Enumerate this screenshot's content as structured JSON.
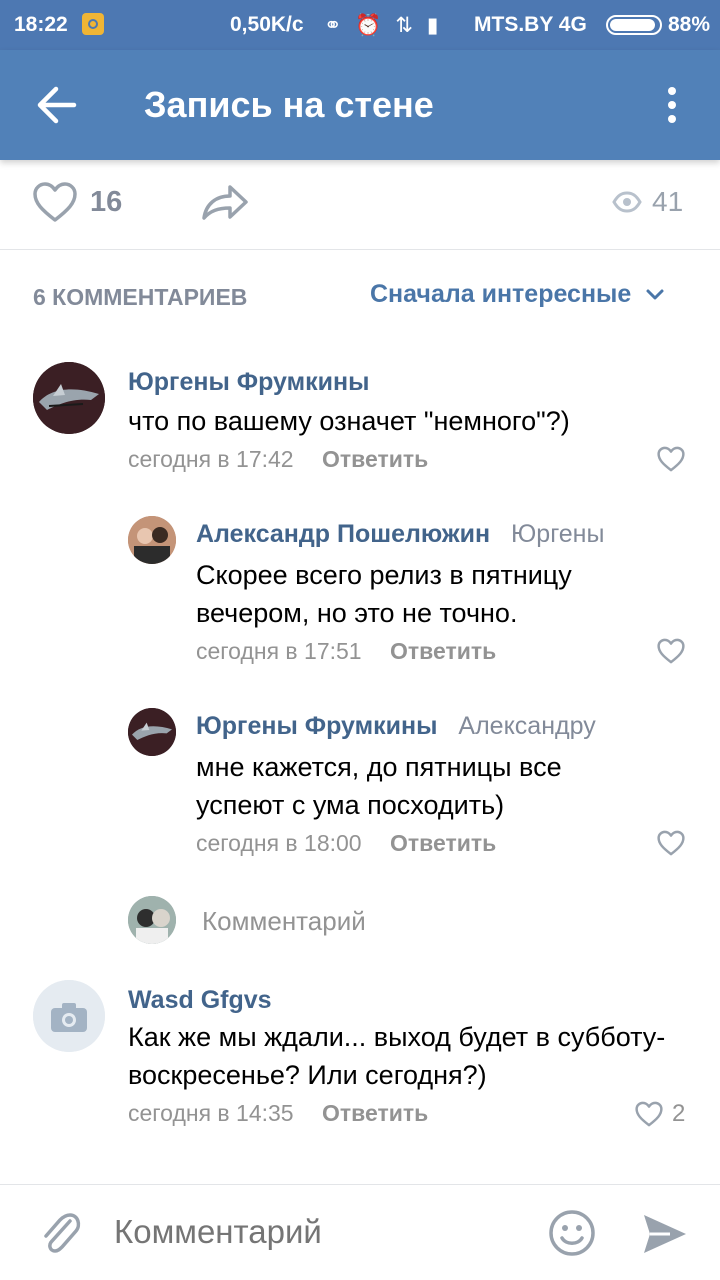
{
  "status_bar": {
    "time": "18:22",
    "speed": "0,50K/c",
    "carrier": "MTS.BY 4G",
    "battery": "88%"
  },
  "app_bar": {
    "title": "Запись на стене",
    "back_icon": "arrow-left-icon",
    "more_icon": "more-vertical-icon"
  },
  "post_actions": {
    "likes": "16",
    "views": "41"
  },
  "comments_header": {
    "count_label": "6 КОММЕНТАРИЕВ",
    "sort_label": "Сначала интересные"
  },
  "comments": [
    {
      "author": "Юргены Фрумкины",
      "reply_to": "",
      "text": "что по вашему означет \"немного\"?)",
      "time": "сегодня в 17:42",
      "reply_label": "Ответить",
      "likes": ""
    },
    {
      "author": "Александр Пошелюжин",
      "reply_to": "Юргены",
      "text": "Скорее всего релиз в пятницу вечером, но это не точно.",
      "time": "сегодня в 17:51",
      "reply_label": "Ответить",
      "likes": ""
    },
    {
      "author": "Юргены Фрумкины",
      "reply_to": "Александру",
      "text": "мне кажется, до пятницы все успеют с ума посходить)",
      "time": "сегодня в 18:00",
      "reply_label": "Ответить",
      "likes": ""
    },
    {
      "author": "Wasd Gfgvs",
      "reply_to": "",
      "text": "Как же мы ждали... выход будет в субботу-воскресенье? Или сегодня?)",
      "time": "сегодня в 14:35",
      "reply_label": "Ответить",
      "likes": "2"
    }
  ],
  "inline_reply": {
    "placeholder": "Комментарий"
  },
  "composer": {
    "placeholder": "Комментарий"
  },
  "colors": {
    "header": "#5181b8",
    "status_bar": "#4d78b2",
    "link": "#42648b",
    "secondary_text": "#939393"
  }
}
